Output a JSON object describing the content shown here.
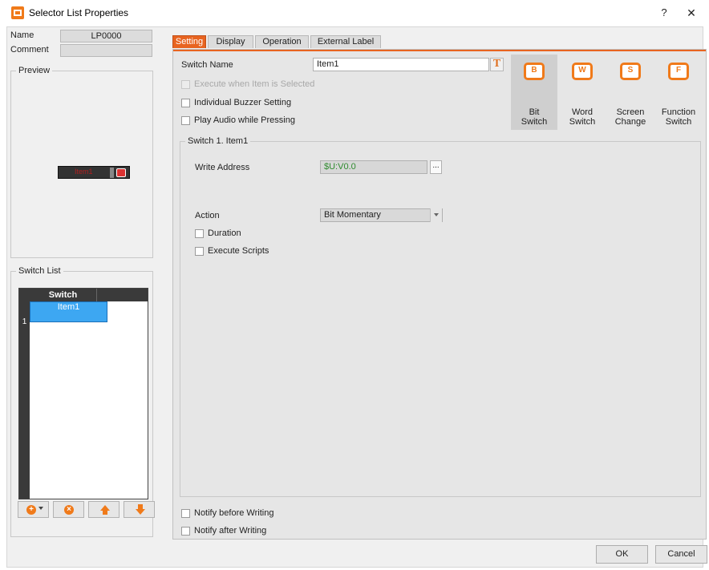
{
  "window": {
    "title": "Selector List Properties",
    "help": "?",
    "close": "✕"
  },
  "left": {
    "name_label": "Name",
    "name_value": "LP0000",
    "comment_label": "Comment",
    "comment_value": "",
    "preview_label": "Preview",
    "preview_text": "Item1",
    "switch_list_label": "Switch List",
    "list_header": "Switch",
    "rows": [
      {
        "num": "1",
        "label": "Item1"
      }
    ],
    "buttons": {
      "add": "+",
      "remove": "×"
    }
  },
  "tabs": [
    "Setting",
    "Display",
    "Operation",
    "External Label"
  ],
  "setting": {
    "switch_name_label": "Switch Name",
    "switch_name_value": "Item1",
    "execute_when_selected": "Execute when Item is Selected",
    "individual_buzzer": "Individual Buzzer Setting",
    "play_audio": "Play Audio while Pressing",
    "types": [
      {
        "letter": "B",
        "line1": "Bit",
        "line2": "Switch"
      },
      {
        "letter": "W",
        "line1": "Word",
        "line2": "Switch"
      },
      {
        "letter": "S",
        "line1": "Screen",
        "line2": "Change"
      },
      {
        "letter": "F",
        "line1": "Function",
        "line2": "Switch"
      }
    ],
    "switch_group_label": "Switch 1. Item1",
    "write_address_label": "Write Address",
    "write_address_value": "$U:V0.0",
    "dots": "...",
    "action_label": "Action",
    "action_value": "Bit Momentary",
    "duration": "Duration",
    "execute_scripts": "Execute Scripts",
    "notify_before": "Notify before Writing",
    "notify_after": "Notify after Writing"
  },
  "footer": {
    "ok": "OK",
    "cancel": "Cancel"
  },
  "colors": {
    "accent": "#e86420",
    "selected": "#3da7f2"
  }
}
